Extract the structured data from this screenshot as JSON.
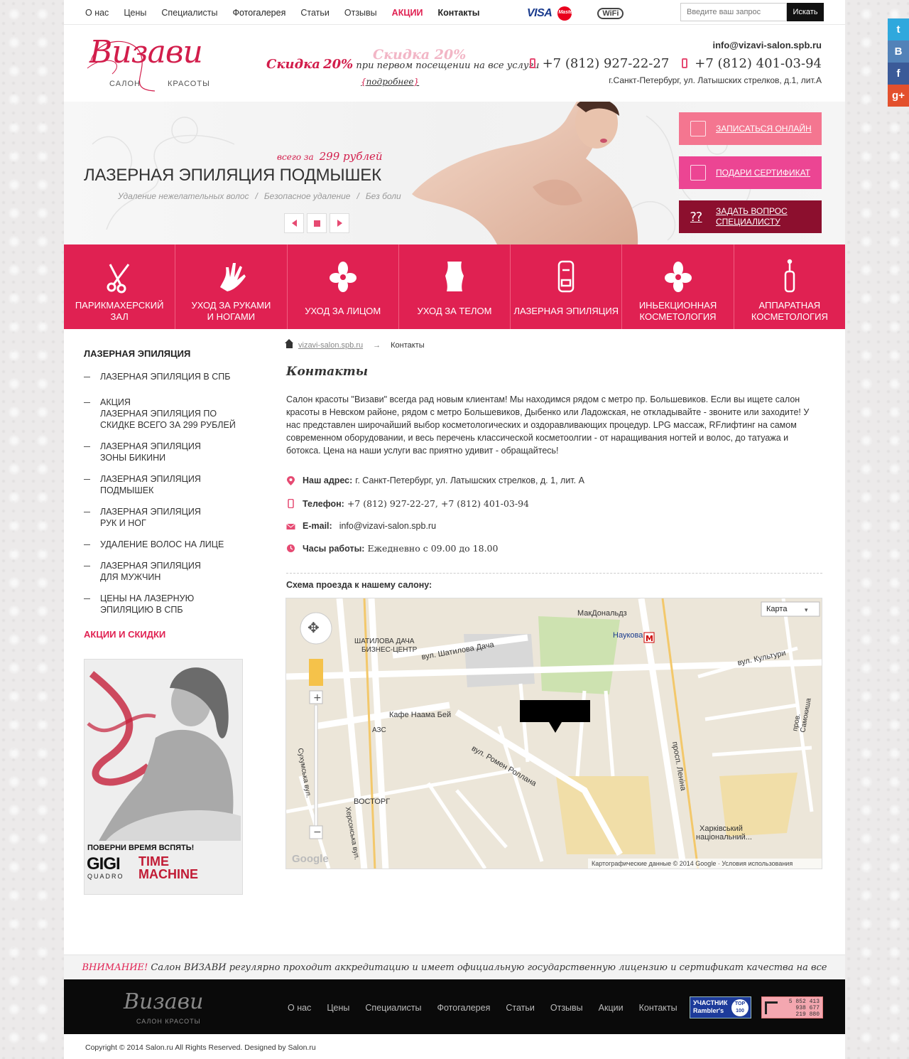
{
  "topnav": {
    "items": [
      "О нас",
      "Цены",
      "Специалисты",
      "Фотогалерея",
      "Статьи",
      "Отзывы",
      "АКЦИИ",
      "Контакты"
    ],
    "search_placeholder": "Введите ваш запрос",
    "search_button": "Искать",
    "payments": {
      "visa": "VISA",
      "mastercard": "MasterCard",
      "wifi": "WiFi"
    }
  },
  "header": {
    "logo_script": "Визави",
    "logo_sub_1": "САЛОН",
    "logo_sub_2": "КРАСОТЫ",
    "promo_ghost": "Скидка 20%",
    "promo_label": "Скидка",
    "promo_value": "20%",
    "promo_rest": "при первом посещении на все услуги",
    "promo_more": "подробнее",
    "email": "info@vizavi-salon.spb.ru",
    "phone1": "+7 (812) 927-22-27",
    "phone2": "+7 (812) 401-03-94",
    "address": "г.Санкт-Петербург, ул. Латышских стрелков,  д.1, лит.А"
  },
  "slider": {
    "price_prefix": "всего за",
    "price": "299 рублей",
    "title": "ЛАЗЕРНАЯ ЭПИЛЯЦИЯ ПОДМЫШЕК",
    "subs": [
      "Удаление нежелательных волос",
      "Безопасное удаление",
      "Без боли"
    ],
    "buttons": [
      "ЗАПИСАТЬСЯ ОНЛАЙН",
      "ПОДАРИ СЕРТИФИКАТ",
      "ЗАДАТЬ ВОПРОС СПЕЦИАЛИСТУ"
    ]
  },
  "services": [
    {
      "l1": "ПАРИКМАХЕРСКИЙ",
      "l2": "ЗАЛ",
      "icon": "scissors-icon"
    },
    {
      "l1": "УХОД ЗА РУКАМИ",
      "l2": "И НОГАМИ",
      "icon": "hand-icon"
    },
    {
      "l1": "УХОД ЗА ЛИЦОМ",
      "l2": "",
      "icon": "orchid-icon"
    },
    {
      "l1": "УХОД ЗА ТЕЛОМ",
      "l2": "",
      "icon": "corset-icon"
    },
    {
      "l1": "ЛАЗЕРНАЯ ЭПИЛЯЦИЯ",
      "l2": "",
      "icon": "laser-device-icon"
    },
    {
      "l1": "ИНЬЕКЦИОННАЯ",
      "l2": "КОСМЕТОЛОГИЯ",
      "icon": "orchid-icon"
    },
    {
      "l1": "АППАРАТНАЯ",
      "l2": "КОСМЕТОЛОГИЯ",
      "icon": "apparatus-icon"
    }
  ],
  "sidebar": {
    "heading": "ЛАЗЕРНАЯ ЭПИЛЯЦИЯ",
    "items": [
      [
        "ЛАЗЕРНАЯ ЭПИЛЯЦИЯ В СПБ"
      ],
      [
        "АКЦИЯ",
        "ЛАЗЕРНАЯ ЭПИЛЯЦИЯ ПО",
        "СКИДКЕ ВСЕГО ЗА 299 РУБЛЕЙ"
      ],
      [
        "ЛАЗЕРНАЯ ЭПИЛЯЦИЯ",
        "ЗОНЫ БИКИНИ"
      ],
      [
        "ЛАЗЕРНАЯ ЭПИЛЯЦИЯ",
        "ПОДМЫШЕК"
      ],
      [
        "ЛАЗЕРНАЯ ЭПИЛЯЦИЯ",
        "РУК И НОГ"
      ],
      [
        "УДАЛЕНИЕ ВОЛОС НА ЛИЦЕ"
      ],
      [
        "ЛАЗЕРНАЯ ЭПИЛЯЦИЯ",
        "ДЛЯ МУЖЧИН"
      ],
      [
        "ЦЕНЫ НА ЛАЗЕРНУЮ",
        "ЭПИЛЯЦИЮ В СПБ"
      ]
    ],
    "promo_heading": "АКЦИИ И СКИДКИ",
    "banner_caption": "ПОВЕРНИ ВРЕМЯ ВСПЯТЬ!",
    "banner_brand": "GIGI",
    "banner_sub": "QUADRO",
    "banner_tm1": "TIME",
    "banner_tm2": "MACHINE"
  },
  "content": {
    "crumb_home": "vizavi-salon.spb.ru",
    "crumb_arrow": "→",
    "crumb_current": "Контакты",
    "title": "Контакты",
    "text": "Салон красоты \"Визави\" всегда рад новым клиентам! Мы находимся рядом с метро пр. Большевиков. Если вы ищете салон красоты в Невском районе, рядом с метро Большевиков, Дыбенко или Ладожская, не откладывайте - звоните или заходите! У нас представлен широчайший выбор косметологических и оздоравливающих процедур. LPG массаж, RFлифтинг на самом современном оборудовании, и весь перечень классической косметоолгии - от наращивания ногтей и волос, до татуажа и ботокса. Цена на наши услуги вас приятно удивит - обращайтесь!",
    "addr_label": "Наш адрес:",
    "addr_value": "г. Санкт-Петербург, ул. Латышских стрелков, д. 1, лит. А",
    "phone_label": "Телефон:",
    "phone_value": "+7 (812) 927-22-27,  +7 (812) 401-03-94",
    "email_label": "E-mail:",
    "email_value": "info@vizavi-salon.spb.ru",
    "hours_label": "Часы работы:",
    "hours_value": "Ежедневно с 09.00 до 18.00",
    "map_heading": "Схема проезда к нашему салону:"
  },
  "map": {
    "type_select": "Карта",
    "labels": [
      "МакДональдз",
      "Наукова",
      "ШАТИЛОВА ДАЧА",
      "БИЗНЕС-ЦЕНТР",
      "вул. Шатилова Дача",
      "вул. Культури",
      "Кафе Наама Бей",
      "АЗС",
      "вул. Ромен Роллана",
      "ВОСТОРГ",
      "Сухумська вул.",
      "Херсонська вул.",
      "просп. Леніна",
      "Харківський",
      "національний...",
      "пров. Самокиша",
      "Google",
      "Картографические данные © 2014 Google · Условия использования"
    ]
  },
  "footer": {
    "notice_label": "ВНИМАНИЕ!",
    "notice_text": "Салон ВИЗАВИ регулярно проходит аккредитацию и имеет официальную государственную лицензию и сертификат качества на все оказываемые виды услуг!",
    "nav": [
      "О нас",
      "Цены",
      "Специалисты",
      "Фотогалерея",
      "Статьи",
      "Отзывы",
      "Акции",
      "Контакты"
    ],
    "logo_script": "Визави",
    "logo_sub": "САЛОН КРАСОТЫ",
    "rambler_1": "УЧАСТНИК",
    "rambler_2": "Rambler's",
    "rambler_top": "TOP 100",
    "counter": [
      "5 852 413",
      "938 677",
      "219 880"
    ],
    "copyright": "Copyright © 2014 Salon.ru All Rights Reserved. Designed by Salon.ru"
  },
  "social": [
    "twitter-icon",
    "vk-icon",
    "facebook-icon",
    "google-plus-icon"
  ],
  "colors": {
    "accent": "#e02152",
    "pink": "#f47690",
    "magenta": "#ec4593",
    "wine": "#8c0f2e"
  }
}
